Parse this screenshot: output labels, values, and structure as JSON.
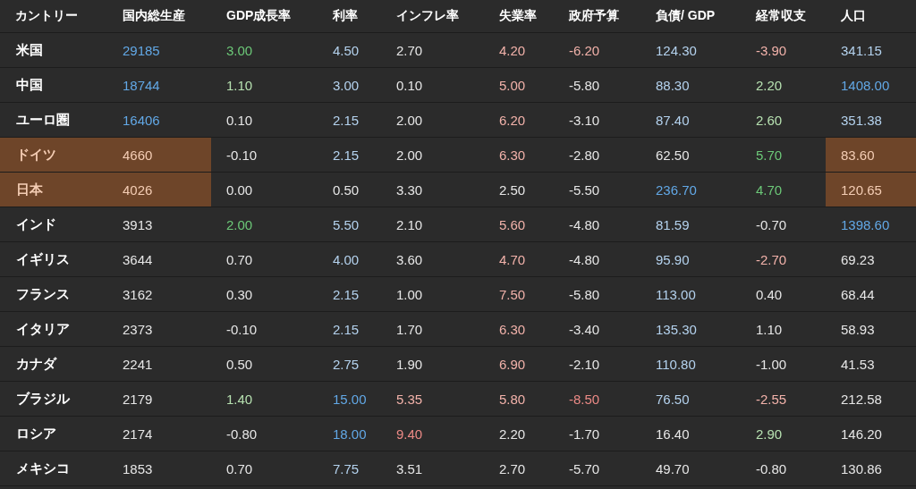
{
  "table": {
    "columns": [
      "カントリー",
      "国内総生産",
      "GDP成長率",
      "利率",
      "インフレ率",
      "失業率",
      "政府予算",
      "負債/ GDP",
      "経常収支",
      "人口"
    ],
    "rows": [
      {
        "cells": [
          {
            "text": "米国",
            "color": "#ffffff",
            "highlighted": false
          },
          {
            "text": "29185",
            "color": "#62a8e6",
            "highlighted": false
          },
          {
            "text": "3.00",
            "color": "#6cc878",
            "highlighted": false
          },
          {
            "text": "4.50",
            "color": "#b4d2ee",
            "highlighted": false
          },
          {
            "text": "2.70",
            "color": "#e6e6e6",
            "highlighted": false
          },
          {
            "text": "4.20",
            "color": "#f2b2aa",
            "highlighted": false
          },
          {
            "text": "-6.20",
            "color": "#f2b2aa",
            "highlighted": false
          },
          {
            "text": "124.30",
            "color": "#b4d2ee",
            "highlighted": false
          },
          {
            "text": "-3.90",
            "color": "#f2b2aa",
            "highlighted": false
          },
          {
            "text": "341.15",
            "color": "#b4d2ee",
            "highlighted": false
          }
        ]
      },
      {
        "cells": [
          {
            "text": "中国",
            "color": "#ffffff",
            "highlighted": false
          },
          {
            "text": "18744",
            "color": "#62a8e6",
            "highlighted": false
          },
          {
            "text": "1.10",
            "color": "#b6e0b0",
            "highlighted": false
          },
          {
            "text": "3.00",
            "color": "#b4d2ee",
            "highlighted": false
          },
          {
            "text": "0.10",
            "color": "#e6e6e6",
            "highlighted": false
          },
          {
            "text": "5.00",
            "color": "#f2b2aa",
            "highlighted": false
          },
          {
            "text": "-5.80",
            "color": "#e6e6e6",
            "highlighted": false
          },
          {
            "text": "88.30",
            "color": "#b4d2ee",
            "highlighted": false
          },
          {
            "text": "2.20",
            "color": "#b6e0b0",
            "highlighted": false
          },
          {
            "text": "1408.00",
            "color": "#62a8e6",
            "highlighted": false
          }
        ]
      },
      {
        "cells": [
          {
            "text": "ユーロ圏",
            "color": "#ffffff",
            "highlighted": false
          },
          {
            "text": "16406",
            "color": "#62a8e6",
            "highlighted": false
          },
          {
            "text": "0.10",
            "color": "#e6e6e6",
            "highlighted": false
          },
          {
            "text": "2.15",
            "color": "#b4d2ee",
            "highlighted": false
          },
          {
            "text": "2.00",
            "color": "#e6e6e6",
            "highlighted": false
          },
          {
            "text": "6.20",
            "color": "#f2b2aa",
            "highlighted": false
          },
          {
            "text": "-3.10",
            "color": "#e6e6e6",
            "highlighted": false
          },
          {
            "text": "87.40",
            "color": "#b4d2ee",
            "highlighted": false
          },
          {
            "text": "2.60",
            "color": "#b6e0b0",
            "highlighted": false
          },
          {
            "text": "351.38",
            "color": "#b4d2ee",
            "highlighted": false
          }
        ]
      },
      {
        "cells": [
          {
            "text": "ドイツ",
            "color": "#f4cdb4",
            "highlighted": true
          },
          {
            "text": "4660",
            "color": "#f4cdb4",
            "highlighted": true
          },
          {
            "text": "-0.10",
            "color": "#e6e6e6",
            "highlighted": false
          },
          {
            "text": "2.15",
            "color": "#b4d2ee",
            "highlighted": false
          },
          {
            "text": "2.00",
            "color": "#e6e6e6",
            "highlighted": false
          },
          {
            "text": "6.30",
            "color": "#f2b2aa",
            "highlighted": false
          },
          {
            "text": "-2.80",
            "color": "#e6e6e6",
            "highlighted": false
          },
          {
            "text": "62.50",
            "color": "#e6e6e6",
            "highlighted": false
          },
          {
            "text": "5.70",
            "color": "#6cc878",
            "highlighted": false
          },
          {
            "text": "83.60",
            "color": "#f4cdb4",
            "highlighted": true
          }
        ]
      },
      {
        "cells": [
          {
            "text": "日本",
            "color": "#f4cdb4",
            "highlighted": true
          },
          {
            "text": "4026",
            "color": "#f4cdb4",
            "highlighted": true
          },
          {
            "text": "0.00",
            "color": "#e6e6e6",
            "highlighted": false
          },
          {
            "text": "0.50",
            "color": "#e6e6e6",
            "highlighted": false
          },
          {
            "text": "3.30",
            "color": "#e6e6e6",
            "highlighted": false
          },
          {
            "text": "2.50",
            "color": "#e6e6e6",
            "highlighted": false
          },
          {
            "text": "-5.50",
            "color": "#e6e6e6",
            "highlighted": false
          },
          {
            "text": "236.70",
            "color": "#62a8e6",
            "highlighted": false
          },
          {
            "text": "4.70",
            "color": "#6cc878",
            "highlighted": false
          },
          {
            "text": "120.65",
            "color": "#f4cdb4",
            "highlighted": true
          }
        ]
      },
      {
        "cells": [
          {
            "text": "インド",
            "color": "#ffffff",
            "highlighted": false
          },
          {
            "text": "3913",
            "color": "#e6e6e6",
            "highlighted": false
          },
          {
            "text": "2.00",
            "color": "#6cc878",
            "highlighted": false
          },
          {
            "text": "5.50",
            "color": "#b4d2ee",
            "highlighted": false
          },
          {
            "text": "2.10",
            "color": "#e6e6e6",
            "highlighted": false
          },
          {
            "text": "5.60",
            "color": "#f2b2aa",
            "highlighted": false
          },
          {
            "text": "-4.80",
            "color": "#e6e6e6",
            "highlighted": false
          },
          {
            "text": "81.59",
            "color": "#b4d2ee",
            "highlighted": false
          },
          {
            "text": "-0.70",
            "color": "#e6e6e6",
            "highlighted": false
          },
          {
            "text": "1398.60",
            "color": "#62a8e6",
            "highlighted": false
          }
        ]
      },
      {
        "cells": [
          {
            "text": "イギリス",
            "color": "#ffffff",
            "highlighted": false
          },
          {
            "text": "3644",
            "color": "#e6e6e6",
            "highlighted": false
          },
          {
            "text": "0.70",
            "color": "#e6e6e6",
            "highlighted": false
          },
          {
            "text": "4.00",
            "color": "#b4d2ee",
            "highlighted": false
          },
          {
            "text": "3.60",
            "color": "#e6e6e6",
            "highlighted": false
          },
          {
            "text": "4.70",
            "color": "#f2b2aa",
            "highlighted": false
          },
          {
            "text": "-4.80",
            "color": "#e6e6e6",
            "highlighted": false
          },
          {
            "text": "95.90",
            "color": "#b4d2ee",
            "highlighted": false
          },
          {
            "text": "-2.70",
            "color": "#f2b2aa",
            "highlighted": false
          },
          {
            "text": "69.23",
            "color": "#e6e6e6",
            "highlighted": false
          }
        ]
      },
      {
        "cells": [
          {
            "text": "フランス",
            "color": "#ffffff",
            "highlighted": false
          },
          {
            "text": "3162",
            "color": "#e6e6e6",
            "highlighted": false
          },
          {
            "text": "0.30",
            "color": "#e6e6e6",
            "highlighted": false
          },
          {
            "text": "2.15",
            "color": "#b4d2ee",
            "highlighted": false
          },
          {
            "text": "1.00",
            "color": "#e6e6e6",
            "highlighted": false
          },
          {
            "text": "7.50",
            "color": "#f2b2aa",
            "highlighted": false
          },
          {
            "text": "-5.80",
            "color": "#e6e6e6",
            "highlighted": false
          },
          {
            "text": "113.00",
            "color": "#b4d2ee",
            "highlighted": false
          },
          {
            "text": "0.40",
            "color": "#e6e6e6",
            "highlighted": false
          },
          {
            "text": "68.44",
            "color": "#e6e6e6",
            "highlighted": false
          }
        ]
      },
      {
        "cells": [
          {
            "text": "イタリア",
            "color": "#ffffff",
            "highlighted": false
          },
          {
            "text": "2373",
            "color": "#e6e6e6",
            "highlighted": false
          },
          {
            "text": "-0.10",
            "color": "#e6e6e6",
            "highlighted": false
          },
          {
            "text": "2.15",
            "color": "#b4d2ee",
            "highlighted": false
          },
          {
            "text": "1.70",
            "color": "#e6e6e6",
            "highlighted": false
          },
          {
            "text": "6.30",
            "color": "#f2b2aa",
            "highlighted": false
          },
          {
            "text": "-3.40",
            "color": "#e6e6e6",
            "highlighted": false
          },
          {
            "text": "135.30",
            "color": "#b4d2ee",
            "highlighted": false
          },
          {
            "text": "1.10",
            "color": "#e6e6e6",
            "highlighted": false
          },
          {
            "text": "58.93",
            "color": "#e6e6e6",
            "highlighted": false
          }
        ]
      },
      {
        "cells": [
          {
            "text": "カナダ",
            "color": "#ffffff",
            "highlighted": false
          },
          {
            "text": "2241",
            "color": "#e6e6e6",
            "highlighted": false
          },
          {
            "text": "0.50",
            "color": "#e6e6e6",
            "highlighted": false
          },
          {
            "text": "2.75",
            "color": "#b4d2ee",
            "highlighted": false
          },
          {
            "text": "1.90",
            "color": "#e6e6e6",
            "highlighted": false
          },
          {
            "text": "6.90",
            "color": "#f2b2aa",
            "highlighted": false
          },
          {
            "text": "-2.10",
            "color": "#e6e6e6",
            "highlighted": false
          },
          {
            "text": "110.80",
            "color": "#b4d2ee",
            "highlighted": false
          },
          {
            "text": "-1.00",
            "color": "#e6e6e6",
            "highlighted": false
          },
          {
            "text": "41.53",
            "color": "#e6e6e6",
            "highlighted": false
          }
        ]
      },
      {
        "cells": [
          {
            "text": "ブラジル",
            "color": "#ffffff",
            "highlighted": false
          },
          {
            "text": "2179",
            "color": "#e6e6e6",
            "highlighted": false
          },
          {
            "text": "1.40",
            "color": "#b6e0b0",
            "highlighted": false
          },
          {
            "text": "15.00",
            "color": "#62a8e6",
            "highlighted": false
          },
          {
            "text": "5.35",
            "color": "#f2b2aa",
            "highlighted": false
          },
          {
            "text": "5.80",
            "color": "#f2b2aa",
            "highlighted": false
          },
          {
            "text": "-8.50",
            "color": "#ec8a86",
            "highlighted": false
          },
          {
            "text": "76.50",
            "color": "#b4d2ee",
            "highlighted": false
          },
          {
            "text": "-2.55",
            "color": "#f2b2aa",
            "highlighted": false
          },
          {
            "text": "212.58",
            "color": "#e6e6e6",
            "highlighted": false
          }
        ]
      },
      {
        "cells": [
          {
            "text": "ロシア",
            "color": "#ffffff",
            "highlighted": false
          },
          {
            "text": "2174",
            "color": "#e6e6e6",
            "highlighted": false
          },
          {
            "text": "-0.80",
            "color": "#e6e6e6",
            "highlighted": false
          },
          {
            "text": "18.00",
            "color": "#62a8e6",
            "highlighted": false
          },
          {
            "text": "9.40",
            "color": "#ec8a86",
            "highlighted": false
          },
          {
            "text": "2.20",
            "color": "#e6e6e6",
            "highlighted": false
          },
          {
            "text": "-1.70",
            "color": "#e6e6e6",
            "highlighted": false
          },
          {
            "text": "16.40",
            "color": "#e6e6e6",
            "highlighted": false
          },
          {
            "text": "2.90",
            "color": "#b6e0b0",
            "highlighted": false
          },
          {
            "text": "146.20",
            "color": "#e6e6e6",
            "highlighted": false
          }
        ]
      },
      {
        "cells": [
          {
            "text": "メキシコ",
            "color": "#ffffff",
            "highlighted": false
          },
          {
            "text": "1853",
            "color": "#e6e6e6",
            "highlighted": false
          },
          {
            "text": "0.70",
            "color": "#e6e6e6",
            "highlighted": false
          },
          {
            "text": "7.75",
            "color": "#b4d2ee",
            "highlighted": false
          },
          {
            "text": "3.51",
            "color": "#e6e6e6",
            "highlighted": false
          },
          {
            "text": "2.70",
            "color": "#e6e6e6",
            "highlighted": false
          },
          {
            "text": "-5.70",
            "color": "#e6e6e6",
            "highlighted": false
          },
          {
            "text": "49.70",
            "color": "#e6e6e6",
            "highlighted": false
          },
          {
            "text": "-0.80",
            "color": "#e6e6e6",
            "highlighted": false
          },
          {
            "text": "130.86",
            "color": "#e6e6e6",
            "highlighted": false
          }
        ]
      }
    ]
  }
}
